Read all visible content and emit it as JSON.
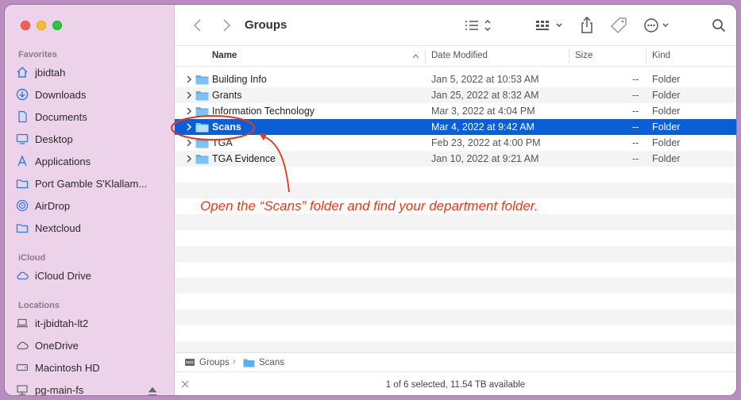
{
  "window": {
    "title": "Groups"
  },
  "sidebar": {
    "favorites_label": "Favorites",
    "favorites": [
      {
        "label": "jbidtah",
        "icon": "home-icon"
      },
      {
        "label": "Downloads",
        "icon": "download-icon"
      },
      {
        "label": "Documents",
        "icon": "document-icon"
      },
      {
        "label": "Desktop",
        "icon": "desktop-icon"
      },
      {
        "label": "Applications",
        "icon": "applications-icon"
      },
      {
        "label": "Port Gamble S'Klallam...",
        "icon": "folder-icon"
      },
      {
        "label": "AirDrop",
        "icon": "airdrop-icon"
      },
      {
        "label": "Nextcloud",
        "icon": "folder-icon"
      }
    ],
    "icloud_label": "iCloud",
    "icloud": [
      {
        "label": "iCloud Drive",
        "icon": "cloud-icon"
      }
    ],
    "locations_label": "Locations",
    "locations": [
      {
        "label": "it-jbidtah-lt2",
        "icon": "laptop-icon"
      },
      {
        "label": "OneDrive",
        "icon": "cloud-icon"
      },
      {
        "label": "Macintosh HD",
        "icon": "disk-icon"
      },
      {
        "label": "pg-main-fs",
        "icon": "network-icon"
      }
    ]
  },
  "columns": {
    "name": "Name",
    "date": "Date Modified",
    "size": "Size",
    "kind": "Kind"
  },
  "rows": [
    {
      "name": "Building Info",
      "date": "Jan 5, 2022 at 10:53 AM",
      "size": "--",
      "kind": "Folder"
    },
    {
      "name": "Grants",
      "date": "Jan 25, 2022 at 8:32 AM",
      "size": "--",
      "kind": "Folder"
    },
    {
      "name": "Information Technology",
      "date": "Mar 3, 2022 at 4:04 PM",
      "size": "--",
      "kind": "Folder"
    },
    {
      "name": "Scans",
      "date": "Mar 4, 2022 at 9:42 AM",
      "size": "--",
      "kind": "Folder"
    },
    {
      "name": "TGA",
      "date": "Feb 23, 2022 at 4:00 PM",
      "size": "--",
      "kind": "Folder"
    },
    {
      "name": "TGA Evidence",
      "date": "Jan 10, 2022 at 9:21 AM",
      "size": "--",
      "kind": "Folder"
    }
  ],
  "path": [
    "Groups",
    "Scans"
  ],
  "status": "1 of 6 selected, 11.54 TB available",
  "annotation": "Open the “Scans” folder and find your department folder.",
  "colors": {
    "selection": "#0a5fd6",
    "sidebar": "#ecd3ea",
    "annotation": "#e03a1e",
    "folder": "#5ab0f0"
  }
}
